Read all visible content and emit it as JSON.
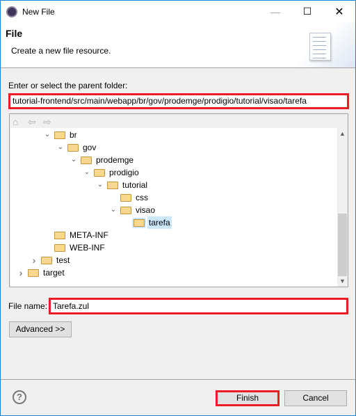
{
  "window": {
    "title": "New File",
    "minimize_icon": "minimize-icon",
    "maximize_icon": "maximize-icon",
    "close_icon": "close-icon"
  },
  "header": {
    "title": "File",
    "description": "Create a new file resource."
  },
  "parent_folder": {
    "label": "Enter or select the parent folder:",
    "value": "tutorial-frontend/src/main/webapp/br/gov/prodemge/prodigio/tutorial/visao/tarefa"
  },
  "tree": {
    "items": [
      {
        "label": "br",
        "level": 3,
        "state": "expanded"
      },
      {
        "label": "gov",
        "level": 4,
        "state": "expanded"
      },
      {
        "label": "prodemge",
        "level": 5,
        "state": "expanded"
      },
      {
        "label": "prodigio",
        "level": 6,
        "state": "expanded"
      },
      {
        "label": "tutorial",
        "level": 7,
        "state": "expanded"
      },
      {
        "label": "css",
        "level": 8,
        "state": "leaf"
      },
      {
        "label": "visao",
        "level": 8,
        "state": "expanded"
      },
      {
        "label": "tarefa",
        "level": 9,
        "state": "leaf",
        "selected": true
      },
      {
        "label": "META-INF",
        "level": 3,
        "state": "leaf"
      },
      {
        "label": "WEB-INF",
        "level": 3,
        "state": "leaf"
      },
      {
        "label": "test",
        "level": 2,
        "state": "collapsed"
      },
      {
        "label": "target",
        "level": 1,
        "state": "collapsed"
      }
    ]
  },
  "file_name": {
    "label": "File name:",
    "value": "Tarefa.zul"
  },
  "buttons": {
    "advanced": "Advanced >>",
    "finish": "Finish",
    "cancel": "Cancel",
    "help": "?"
  },
  "colors": {
    "highlight": "#ed1c24",
    "selection": "#cce8ff",
    "window_border": "#1883d7"
  }
}
